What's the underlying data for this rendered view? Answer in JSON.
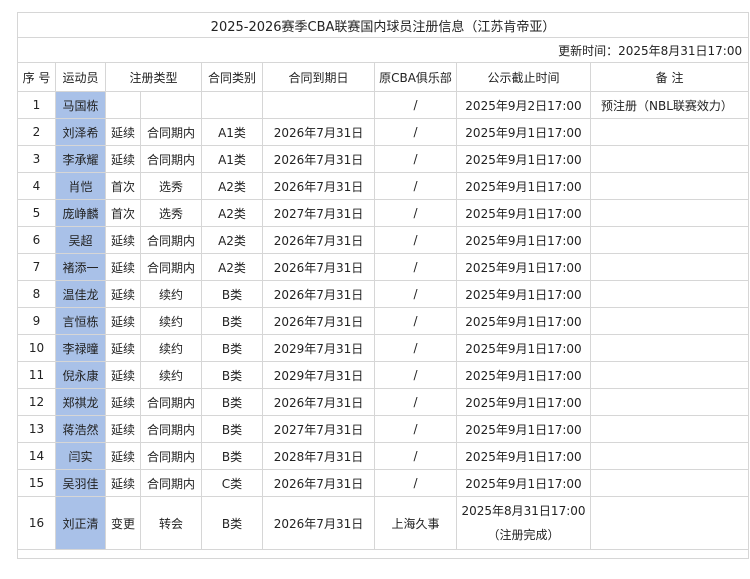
{
  "title": "2025-2026赛季CBA联赛国内球员注册信息（江苏肯帝亚）",
  "update_time": "更新时间：2025年8月31日17:00",
  "headers": [
    "序 号",
    "运动员",
    "注册类型",
    "合同类别",
    "合同到期日",
    "原CBA俱乐部",
    "公示截止时间",
    "备 注"
  ],
  "rows": [
    {
      "no": "1",
      "player": "马国栋",
      "type1": "",
      "type2": "",
      "contract": "",
      "expiry": "",
      "club": "/",
      "deadline": "2025年9月2日17:00",
      "remark": "预注册（NBL联赛效力）"
    },
    {
      "no": "2",
      "player": "刘泽希",
      "type1": "延续",
      "type2": "合同期内",
      "contract": "A1类",
      "expiry": "2026年7月31日",
      "club": "/",
      "deadline": "2025年9月1日17:00",
      "remark": ""
    },
    {
      "no": "3",
      "player": "李承耀",
      "type1": "延续",
      "type2": "合同期内",
      "contract": "A1类",
      "expiry": "2026年7月31日",
      "club": "/",
      "deadline": "2025年9月1日17:00",
      "remark": ""
    },
    {
      "no": "4",
      "player": "肖恺",
      "type1": "首次",
      "type2": "选秀",
      "contract": "A2类",
      "expiry": "2026年7月31日",
      "club": "/",
      "deadline": "2025年9月1日17:00",
      "remark": ""
    },
    {
      "no": "5",
      "player": "庞峥麟",
      "type1": "首次",
      "type2": "选秀",
      "contract": "A2类",
      "expiry": "2027年7月31日",
      "club": "/",
      "deadline": "2025年9月1日17:00",
      "remark": ""
    },
    {
      "no": "6",
      "player": "吴超",
      "type1": "延续",
      "type2": "合同期内",
      "contract": "A2类",
      "expiry": "2026年7月31日",
      "club": "/",
      "deadline": "2025年9月1日17:00",
      "remark": ""
    },
    {
      "no": "7",
      "player": "褚添一",
      "type1": "延续",
      "type2": "合同期内",
      "contract": "A2类",
      "expiry": "2026年7月31日",
      "club": "/",
      "deadline": "2025年9月1日17:00",
      "remark": ""
    },
    {
      "no": "8",
      "player": "温佳龙",
      "type1": "延续",
      "type2": "续约",
      "contract": "B类",
      "expiry": "2026年7月31日",
      "club": "/",
      "deadline": "2025年9月1日17:00",
      "remark": ""
    },
    {
      "no": "9",
      "player": "言恒栋",
      "type1": "延续",
      "type2": "续约",
      "contract": "B类",
      "expiry": "2026年7月31日",
      "club": "/",
      "deadline": "2025年9月1日17:00",
      "remark": ""
    },
    {
      "no": "10",
      "player": "李禄曈",
      "type1": "延续",
      "type2": "续约",
      "contract": "B类",
      "expiry": "2029年7月31日",
      "club": "/",
      "deadline": "2025年9月1日17:00",
      "remark": ""
    },
    {
      "no": "11",
      "player": "倪永康",
      "type1": "延续",
      "type2": "续约",
      "contract": "B类",
      "expiry": "2029年7月31日",
      "club": "/",
      "deadline": "2025年9月1日17:00",
      "remark": ""
    },
    {
      "no": "12",
      "player": "郑祺龙",
      "type1": "延续",
      "type2": "合同期内",
      "contract": "B类",
      "expiry": "2026年7月31日",
      "club": "/",
      "deadline": "2025年9月1日17:00",
      "remark": ""
    },
    {
      "no": "13",
      "player": "蒋浩然",
      "type1": "延续",
      "type2": "合同期内",
      "contract": "B类",
      "expiry": "2027年7月31日",
      "club": "/",
      "deadline": "2025年9月1日17:00",
      "remark": ""
    },
    {
      "no": "14",
      "player": "闫实",
      "type1": "延续",
      "type2": "合同期内",
      "contract": "B类",
      "expiry": "2028年7月31日",
      "club": "/",
      "deadline": "2025年9月1日17:00",
      "remark": ""
    },
    {
      "no": "15",
      "player": "吴羽佳",
      "type1": "延续",
      "type2": "合同期内",
      "contract": "C类",
      "expiry": "2026年7月31日",
      "club": "/",
      "deadline": "2025年9月1日17:00",
      "remark": ""
    },
    {
      "no": "16",
      "player": "刘正清",
      "type1": "变更",
      "type2": "转会",
      "contract": "B类",
      "expiry": "2026年7月31日",
      "club": "上海久事",
      "deadline": "2025年8月31日17:00",
      "deadline_note": "（注册完成）",
      "remark": ""
    }
  ],
  "colors": {
    "player_highlight": "#a9c1e8",
    "border": "#d6d6d6"
  }
}
